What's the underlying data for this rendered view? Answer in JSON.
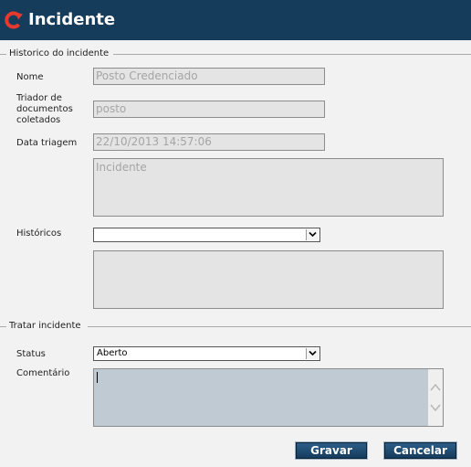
{
  "window": {
    "title": "Incidente",
    "logo_icon": "refresh-arrow-icon",
    "title_bar_color": "#163c5c"
  },
  "historico": {
    "section_label": "Historico do incidente",
    "nome": {
      "label": "Nome",
      "value": "Posto Credenciado"
    },
    "triador": {
      "label_lines": [
        "Triador de",
        "documentos",
        "coletados"
      ],
      "value": "posto"
    },
    "data_triagem": {
      "label": "Data triagem",
      "value": "22/10/2013 14:57:06"
    },
    "descricao": {
      "value": "Incidente"
    },
    "historicos": {
      "label": "Históricos",
      "selected": ""
    },
    "historico_text": {
      "value": ""
    }
  },
  "tratar": {
    "section_label": "Tratar incidente",
    "status": {
      "label": "Status",
      "selected": "Aberto"
    },
    "comentario": {
      "label": "Comentário",
      "value": ""
    }
  },
  "buttons": {
    "save_label": "Gravar",
    "cancel_label": "Cancelar"
  }
}
